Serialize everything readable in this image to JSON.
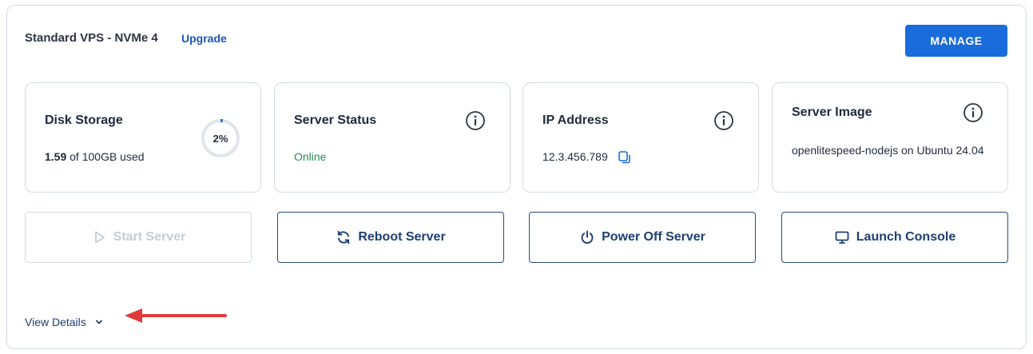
{
  "header": {
    "plan_name": "Standard VPS - NVMe 4",
    "upgrade_label": "Upgrade",
    "manage_label": "MANAGE"
  },
  "cards": {
    "disk": {
      "title": "Disk Storage",
      "used": "1.59",
      "suffix": " of 100GB used",
      "percent_label": "2%",
      "percent_value": 2
    },
    "status": {
      "title": "Server Status",
      "value": "Online"
    },
    "ip": {
      "title": "IP Address",
      "value": "12.3.456.789"
    },
    "image": {
      "title": "Server Image",
      "value": "openlitespeed-nodejs on Ubuntu 24.04"
    }
  },
  "actions": {
    "start": "Start Server",
    "reboot": "Reboot Server",
    "power_off": "Power Off Server",
    "console": "Launch Console"
  },
  "footer": {
    "view_details": "View Details"
  },
  "colors": {
    "primary": "#1a6bdb",
    "navy": "#1d3f72",
    "online": "#2c8a57",
    "annotation": "#e03a3a"
  }
}
